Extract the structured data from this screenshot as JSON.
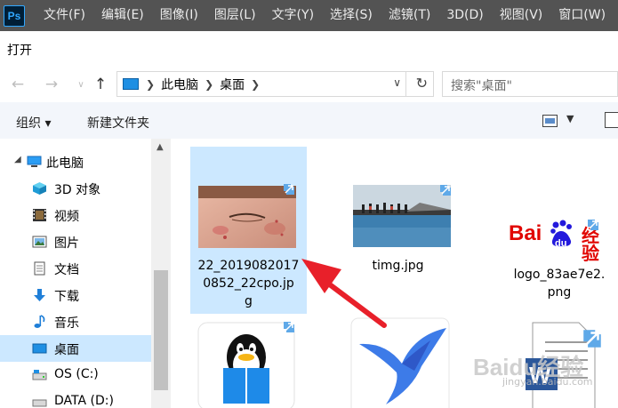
{
  "photoshop": {
    "logo": "Ps",
    "menus": [
      "文件(F)",
      "编辑(E)",
      "图像(I)",
      "图层(L)",
      "文字(Y)",
      "选择(S)",
      "滤镜(T)",
      "3D(D)",
      "视图(V)",
      "窗口(W)"
    ]
  },
  "dialog": {
    "title": "打开"
  },
  "address": {
    "crumbs": [
      "此电脑",
      "桌面"
    ]
  },
  "search": {
    "placeholder": "搜索\"桌面\""
  },
  "toolbar": {
    "organize": "组织 ▾",
    "new_folder": "新建文件夹"
  },
  "sidebar": {
    "items": [
      {
        "label": "此电脑",
        "icon": "pc-icon"
      },
      {
        "label": "3D 对象",
        "icon": "3d-objects-icon"
      },
      {
        "label": "视频",
        "icon": "video-icon"
      },
      {
        "label": "图片",
        "icon": "pictures-icon"
      },
      {
        "label": "文档",
        "icon": "documents-icon"
      },
      {
        "label": "下载",
        "icon": "download-icon"
      },
      {
        "label": "音乐",
        "icon": "music-icon"
      },
      {
        "label": "桌面",
        "icon": "desktop-icon"
      },
      {
        "label": "OS (C:)",
        "icon": "drive-icon"
      },
      {
        "label": "DATA (D:)",
        "icon": "drive-icon"
      }
    ]
  },
  "files": [
    {
      "name_lines": [
        "22_2019082017",
        "0852_22cpo.jp",
        "g"
      ]
    },
    {
      "name_lines": [
        "timg.jpg"
      ]
    },
    {
      "name_lines": [
        "logo_83ae7e2.",
        "png"
      ]
    }
  ],
  "logo_text": {
    "bai": "Bai",
    "du": "du",
    "jingyan": "经验"
  },
  "watermark": {
    "main": "Baidu经验",
    "sub": "jingyan.baidu.com"
  },
  "colors": {
    "ps_menubar": "#535353",
    "selection": "#cce8ff",
    "arrow": "#e8202a",
    "accent": "#1f8fe3"
  }
}
